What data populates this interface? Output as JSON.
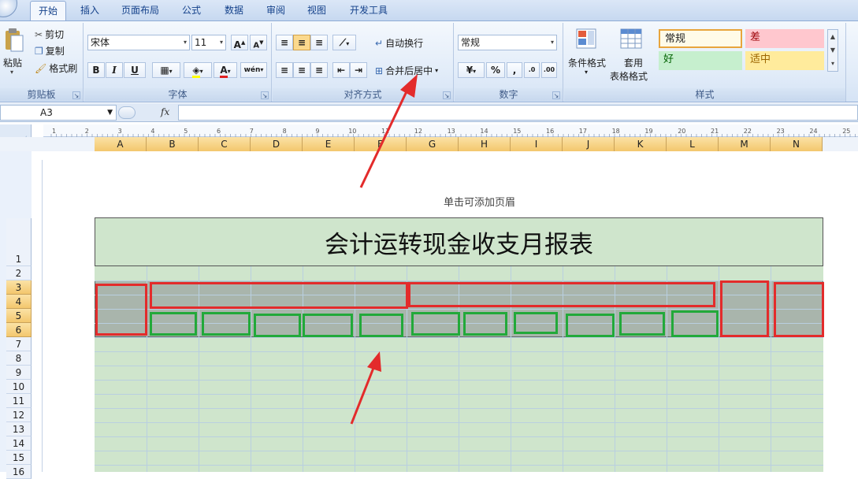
{
  "tabs": [
    "开始",
    "插入",
    "页面布局",
    "公式",
    "数据",
    "审阅",
    "视图",
    "开发工具"
  ],
  "clipboard": {
    "paste": "粘贴",
    "cut": "剪切",
    "copy": "复制",
    "format_painter": "格式刷",
    "group_label": "剪贴板"
  },
  "font": {
    "name": "宋体",
    "size": "11",
    "bold": "B",
    "italic": "I",
    "underline": "U",
    "grow": "A",
    "shrink": "A",
    "font_color": "A",
    "phonetic": "wén",
    "group_label": "字体"
  },
  "alignment": {
    "wrap_text": "自动换行",
    "merge_center": "合并后居中",
    "group_label": "对齐方式"
  },
  "number": {
    "format": "常规",
    "percent": "%",
    "comma": ",",
    "group_label": "数字"
  },
  "styles": {
    "conditional": "条件格式",
    "table_format_line1": "套用",
    "table_format_line2": "表格格式",
    "normal": "常规",
    "bad": "差",
    "good": "好",
    "neutral": "适中",
    "group_label": "样式",
    "colors": {
      "bad_bg": "#ffc7ce",
      "good_bg": "#c6efce",
      "neutral_bg": "#ffeb9c"
    }
  },
  "formula_bar": {
    "name_box": "A3",
    "fx": "fx"
  },
  "ruler_ticks": [
    "1",
    "2",
    "3",
    "4",
    "5",
    "6",
    "7",
    "8",
    "9",
    "10",
    "11",
    "12",
    "13",
    "14",
    "15",
    "16",
    "17",
    "18",
    "19",
    "20",
    "21",
    "22",
    "23",
    "24",
    "25"
  ],
  "columns": [
    "A",
    "B",
    "C",
    "D",
    "E",
    "F",
    "G",
    "H",
    "I",
    "J",
    "K",
    "L",
    "M",
    "N"
  ],
  "rows": [
    "1",
    "2",
    "3",
    "4",
    "5",
    "6",
    "7",
    "8",
    "9",
    "10",
    "11",
    "12",
    "13",
    "14",
    "15",
    "16"
  ],
  "sheet": {
    "header_placeholder": "单击可添加页眉",
    "title": "会计运转现金收支月报表"
  },
  "colors": {
    "annotation_red": "#e32b2b",
    "annotation_green": "#22a93a",
    "sheet_fill": "#cfe5cc",
    "header_fill": "#a9b5ac"
  }
}
